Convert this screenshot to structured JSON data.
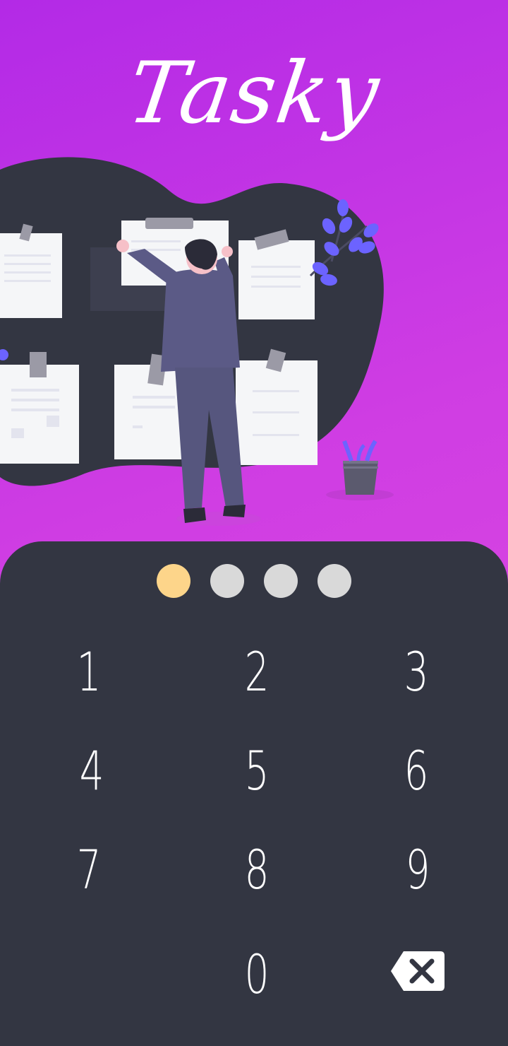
{
  "app": {
    "title": "Tasky"
  },
  "pin": {
    "length": 4,
    "entered": 1,
    "filled_color": "#fdd58a",
    "empty_color": "#d9d9d9"
  },
  "keypad": {
    "keys": [
      "1",
      "2",
      "3",
      "4",
      "5",
      "6",
      "7",
      "8",
      "9",
      "0"
    ],
    "backspace_icon": "backspace-icon"
  },
  "colors": {
    "gradient_top": "#b32ae6",
    "gradient_bottom": "#e04ee0",
    "panel": "#333642",
    "text": "#ffffff"
  }
}
